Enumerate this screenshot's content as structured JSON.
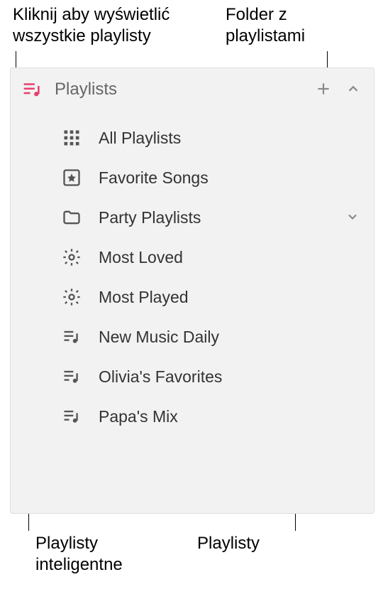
{
  "annotations": {
    "top_left": "Kliknij aby wyświetlić wszystkie playlisty",
    "top_right": "Folder z playlistami",
    "bottom_left": "Playlisty inteligentne",
    "bottom_right": "Playlisty"
  },
  "sidebar": {
    "header": {
      "label": "Playlists"
    },
    "items": [
      {
        "label": "All Playlists",
        "icon": "grid-icon"
      },
      {
        "label": "Favorite Songs",
        "icon": "star-box-icon"
      },
      {
        "label": "Party Playlists",
        "icon": "folder-icon",
        "has_chevron": true
      },
      {
        "label": "Most Loved",
        "icon": "gear-icon"
      },
      {
        "label": "Most Played",
        "icon": "gear-icon"
      },
      {
        "label": "New Music Daily",
        "icon": "playlist-icon"
      },
      {
        "label": "Olivia's Favorites",
        "icon": "playlist-icon"
      },
      {
        "label": "Papa's Mix",
        "icon": "playlist-icon"
      }
    ]
  }
}
